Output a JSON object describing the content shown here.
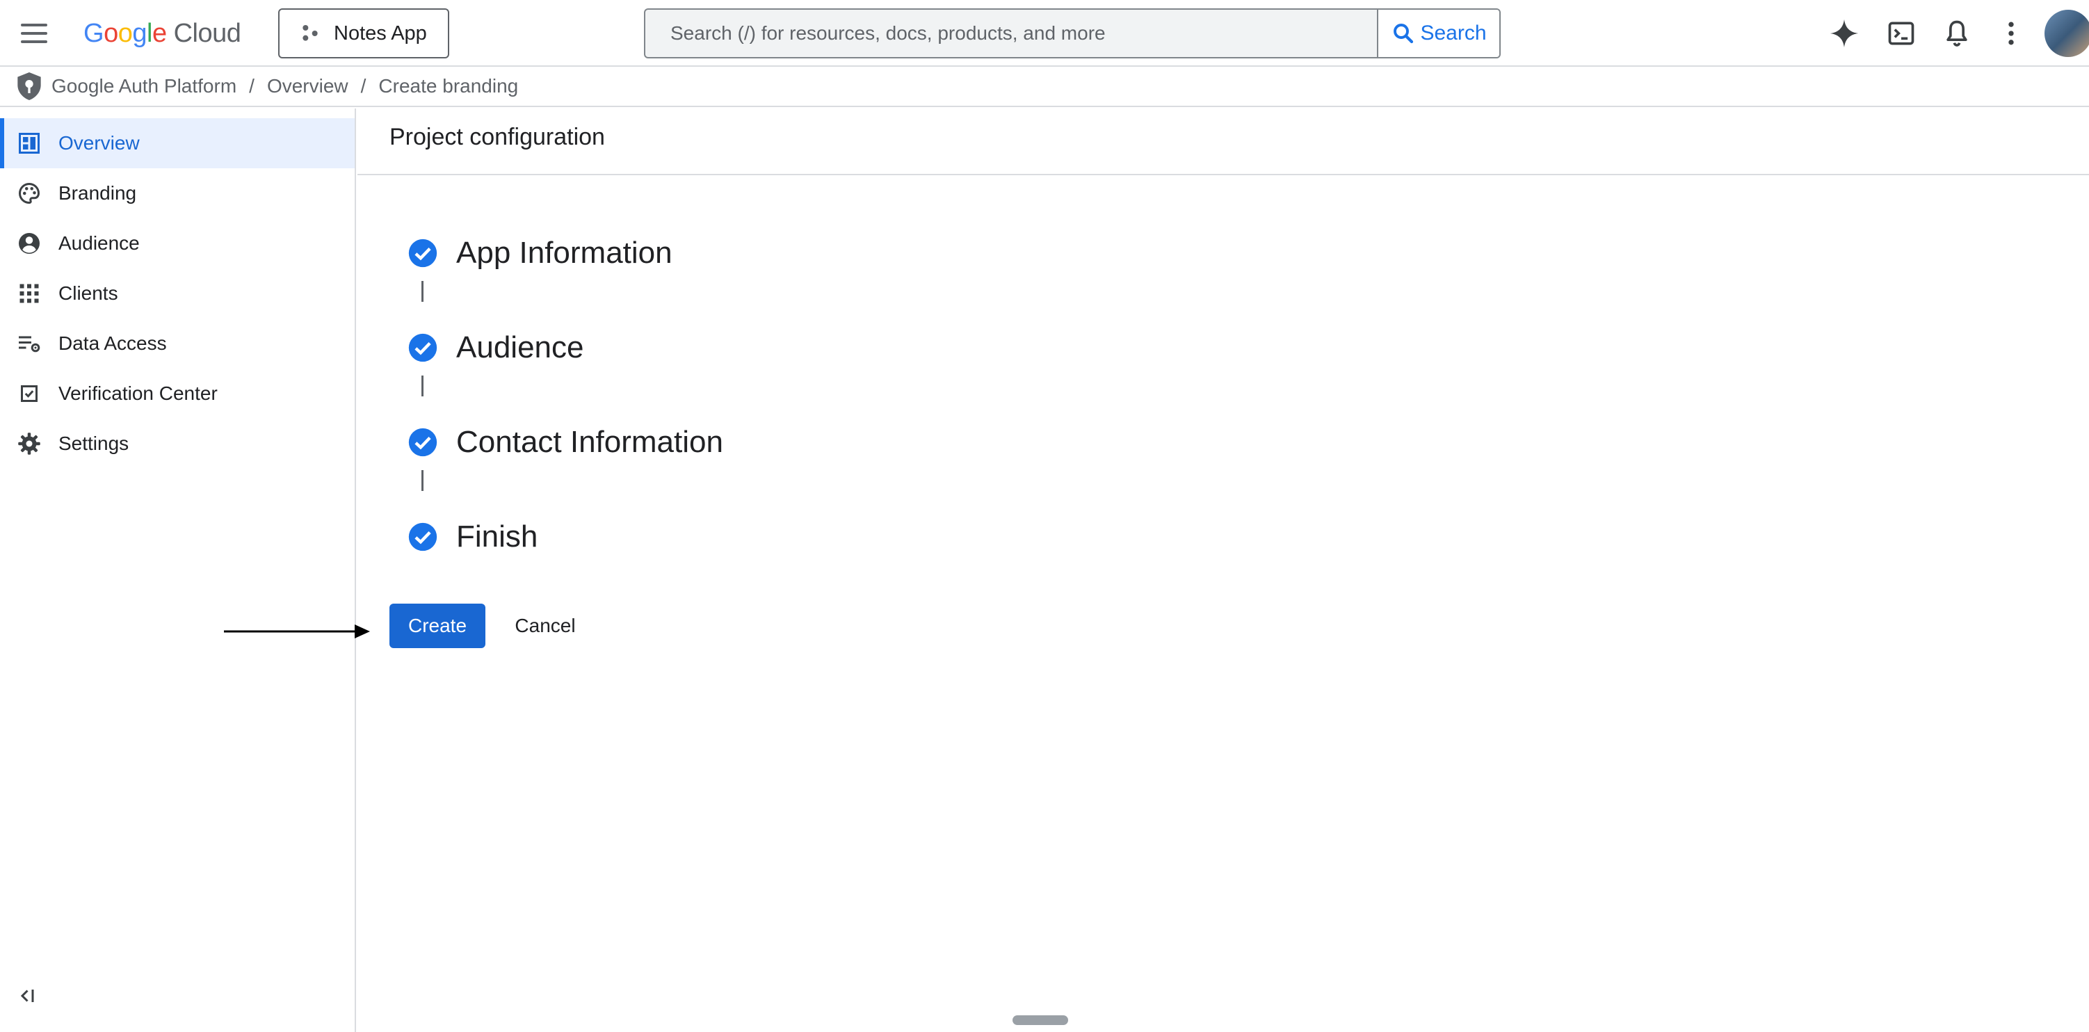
{
  "header": {
    "logo_google": [
      "G",
      "o",
      "o",
      "g",
      "l",
      "e"
    ],
    "logo_cloud": "Cloud",
    "project_name": "Notes App",
    "search_placeholder": "Search (/) for resources, docs, products, and more",
    "search_button": "Search"
  },
  "breadcrumb": {
    "items": [
      "Google Auth Platform",
      "Overview",
      "Create branding"
    ],
    "separator": "/"
  },
  "sidebar": {
    "items": [
      {
        "label": "Overview",
        "icon": "dashboard-icon",
        "active": true
      },
      {
        "label": "Branding",
        "icon": "palette-icon",
        "active": false
      },
      {
        "label": "Audience",
        "icon": "account-circle-icon",
        "active": false
      },
      {
        "label": "Clients",
        "icon": "apps-grid-icon",
        "active": false
      },
      {
        "label": "Data Access",
        "icon": "data-access-icon",
        "active": false
      },
      {
        "label": "Verification Center",
        "icon": "verified-checkbox-icon",
        "active": false
      },
      {
        "label": "Settings",
        "icon": "gear-icon",
        "active": false
      }
    ],
    "collapse_icon": "collapse-sidebar-icon"
  },
  "main": {
    "title": "Project configuration",
    "steps": [
      {
        "label": "App Information",
        "complete": true
      },
      {
        "label": "Audience",
        "complete": true
      },
      {
        "label": "Contact Information",
        "complete": true
      },
      {
        "label": "Finish",
        "complete": true
      }
    ],
    "create_label": "Create",
    "cancel_label": "Cancel"
  },
  "colors": {
    "accent": "#1a73e8",
    "primary_button": "#1967d2",
    "active_nav_bg": "#e8f0fe",
    "divider": "#dadce0"
  }
}
